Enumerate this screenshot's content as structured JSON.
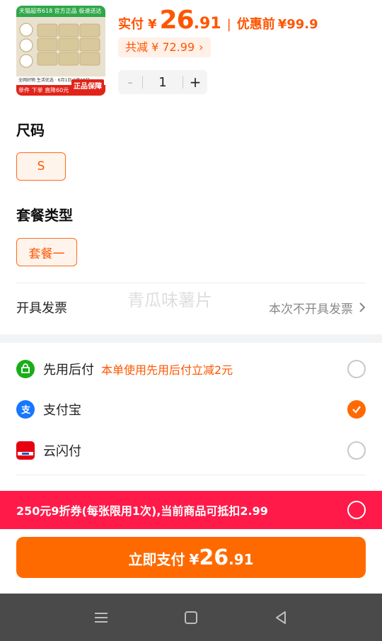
{
  "product": {
    "thumb_top_text": "天猫超市618 官方正品 极速送达",
    "thumb_strip_text": "全网好物 生活优选 · 6月1日-6月18日",
    "thumb_bottom_text": "单件 下单 直降60元",
    "thumb_badge": "正品保障"
  },
  "price": {
    "paid_label": "实付",
    "currency": "¥",
    "paid_int": "26",
    "paid_dec": ".91",
    "separator": "|",
    "original_label": "优惠前",
    "original_value": "¥99.9",
    "saving_label": "共减 ¥ 72.99",
    "saving_arrow": "›"
  },
  "quantity": {
    "minus": "-",
    "value": "1",
    "plus": "+"
  },
  "size": {
    "title": "尺码",
    "options": [
      "S"
    ],
    "selected": "S"
  },
  "package": {
    "title": "套餐类型",
    "options": [
      "套餐一"
    ],
    "selected": "套餐一"
  },
  "invoice": {
    "label": "开具发票",
    "value": "本次不开具发票",
    "arrow": "›"
  },
  "watermark": "青瓜味薯片",
  "payment_methods": [
    {
      "name": "先用后付",
      "promo": "本单使用先用后付立减2元",
      "icon": "pay-later-icon",
      "color": "#1aad19",
      "checked": false
    },
    {
      "name": "支付宝",
      "promo": "",
      "icon": "alipay-icon",
      "color": "#1677ff",
      "checked": true
    },
    {
      "name": "云闪付",
      "promo": "",
      "icon": "unionpay-icon",
      "color": "#e60012",
      "checked": false
    }
  ],
  "coupon": {
    "text": "250元9折券(每张限用1次),当前商品可抵扣2.99",
    "checked": false
  },
  "pay_button": {
    "label": "立即支付",
    "currency": "¥",
    "int": "26",
    "dec": ".91"
  },
  "colors": {
    "accent": "#ff6a00",
    "price": "#ff5500",
    "coupon_bg": "#ff1a4a",
    "nav_bg": "#4a4a4a"
  }
}
